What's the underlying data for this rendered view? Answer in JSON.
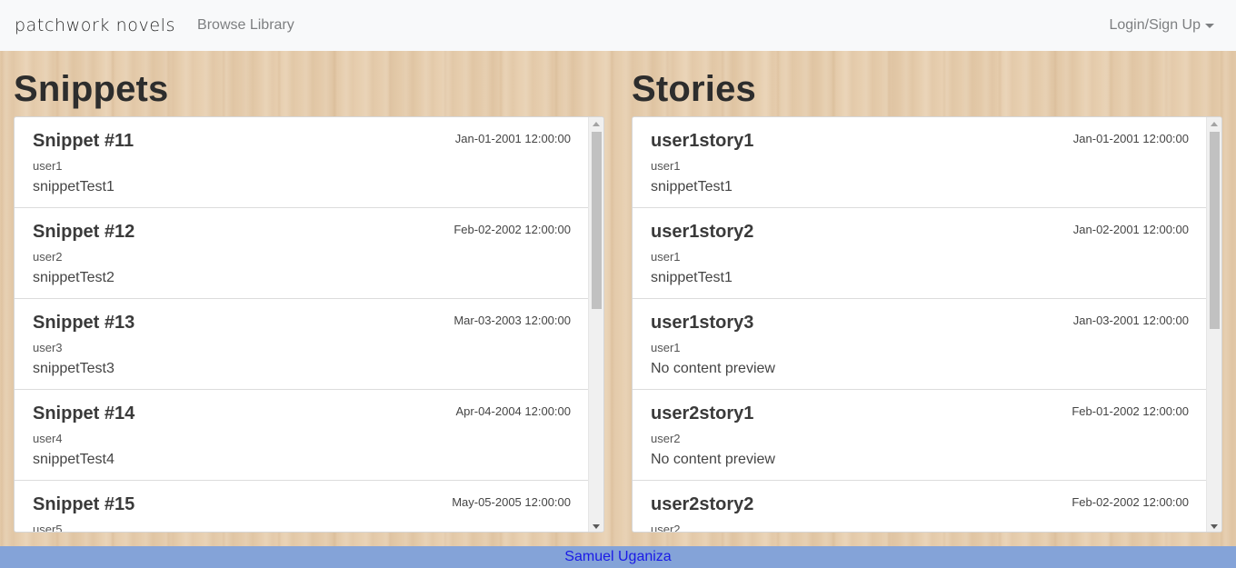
{
  "navbar": {
    "brand": "patchwork novels",
    "browse_label": "Browse Library",
    "login_label": "Login/Sign Up"
  },
  "snippets": {
    "heading": "Snippets",
    "items": [
      {
        "title": "Snippet #11",
        "date": "Jan-01-2001 12:00:00",
        "user": "user1",
        "preview": "snippetTest1"
      },
      {
        "title": "Snippet #12",
        "date": "Feb-02-2002 12:00:00",
        "user": "user2",
        "preview": "snippetTest2"
      },
      {
        "title": "Snippet #13",
        "date": "Mar-03-2003 12:00:00",
        "user": "user3",
        "preview": "snippetTest3"
      },
      {
        "title": "Snippet #14",
        "date": "Apr-04-2004 12:00:00",
        "user": "user4",
        "preview": "snippetTest4"
      },
      {
        "title": "Snippet #15",
        "date": "May-05-2005 12:00:00",
        "user": "user5",
        "preview": ""
      }
    ]
  },
  "stories": {
    "heading": "Stories",
    "items": [
      {
        "title": "user1story1",
        "date": "Jan-01-2001 12:00:00",
        "user": "user1",
        "preview": "snippetTest1"
      },
      {
        "title": "user1story2",
        "date": "Jan-02-2001 12:00:00",
        "user": "user1",
        "preview": "snippetTest1"
      },
      {
        "title": "user1story3",
        "date": "Jan-03-2001 12:00:00",
        "user": "user1",
        "preview": "No content preview"
      },
      {
        "title": "user2story1",
        "date": "Feb-01-2002 12:00:00",
        "user": "user2",
        "preview": "No content preview"
      },
      {
        "title": "user2story2",
        "date": "Feb-02-2002 12:00:00",
        "user": "user2",
        "preview": ""
      }
    ]
  },
  "footer": {
    "name": "Samuel Uganiza"
  }
}
